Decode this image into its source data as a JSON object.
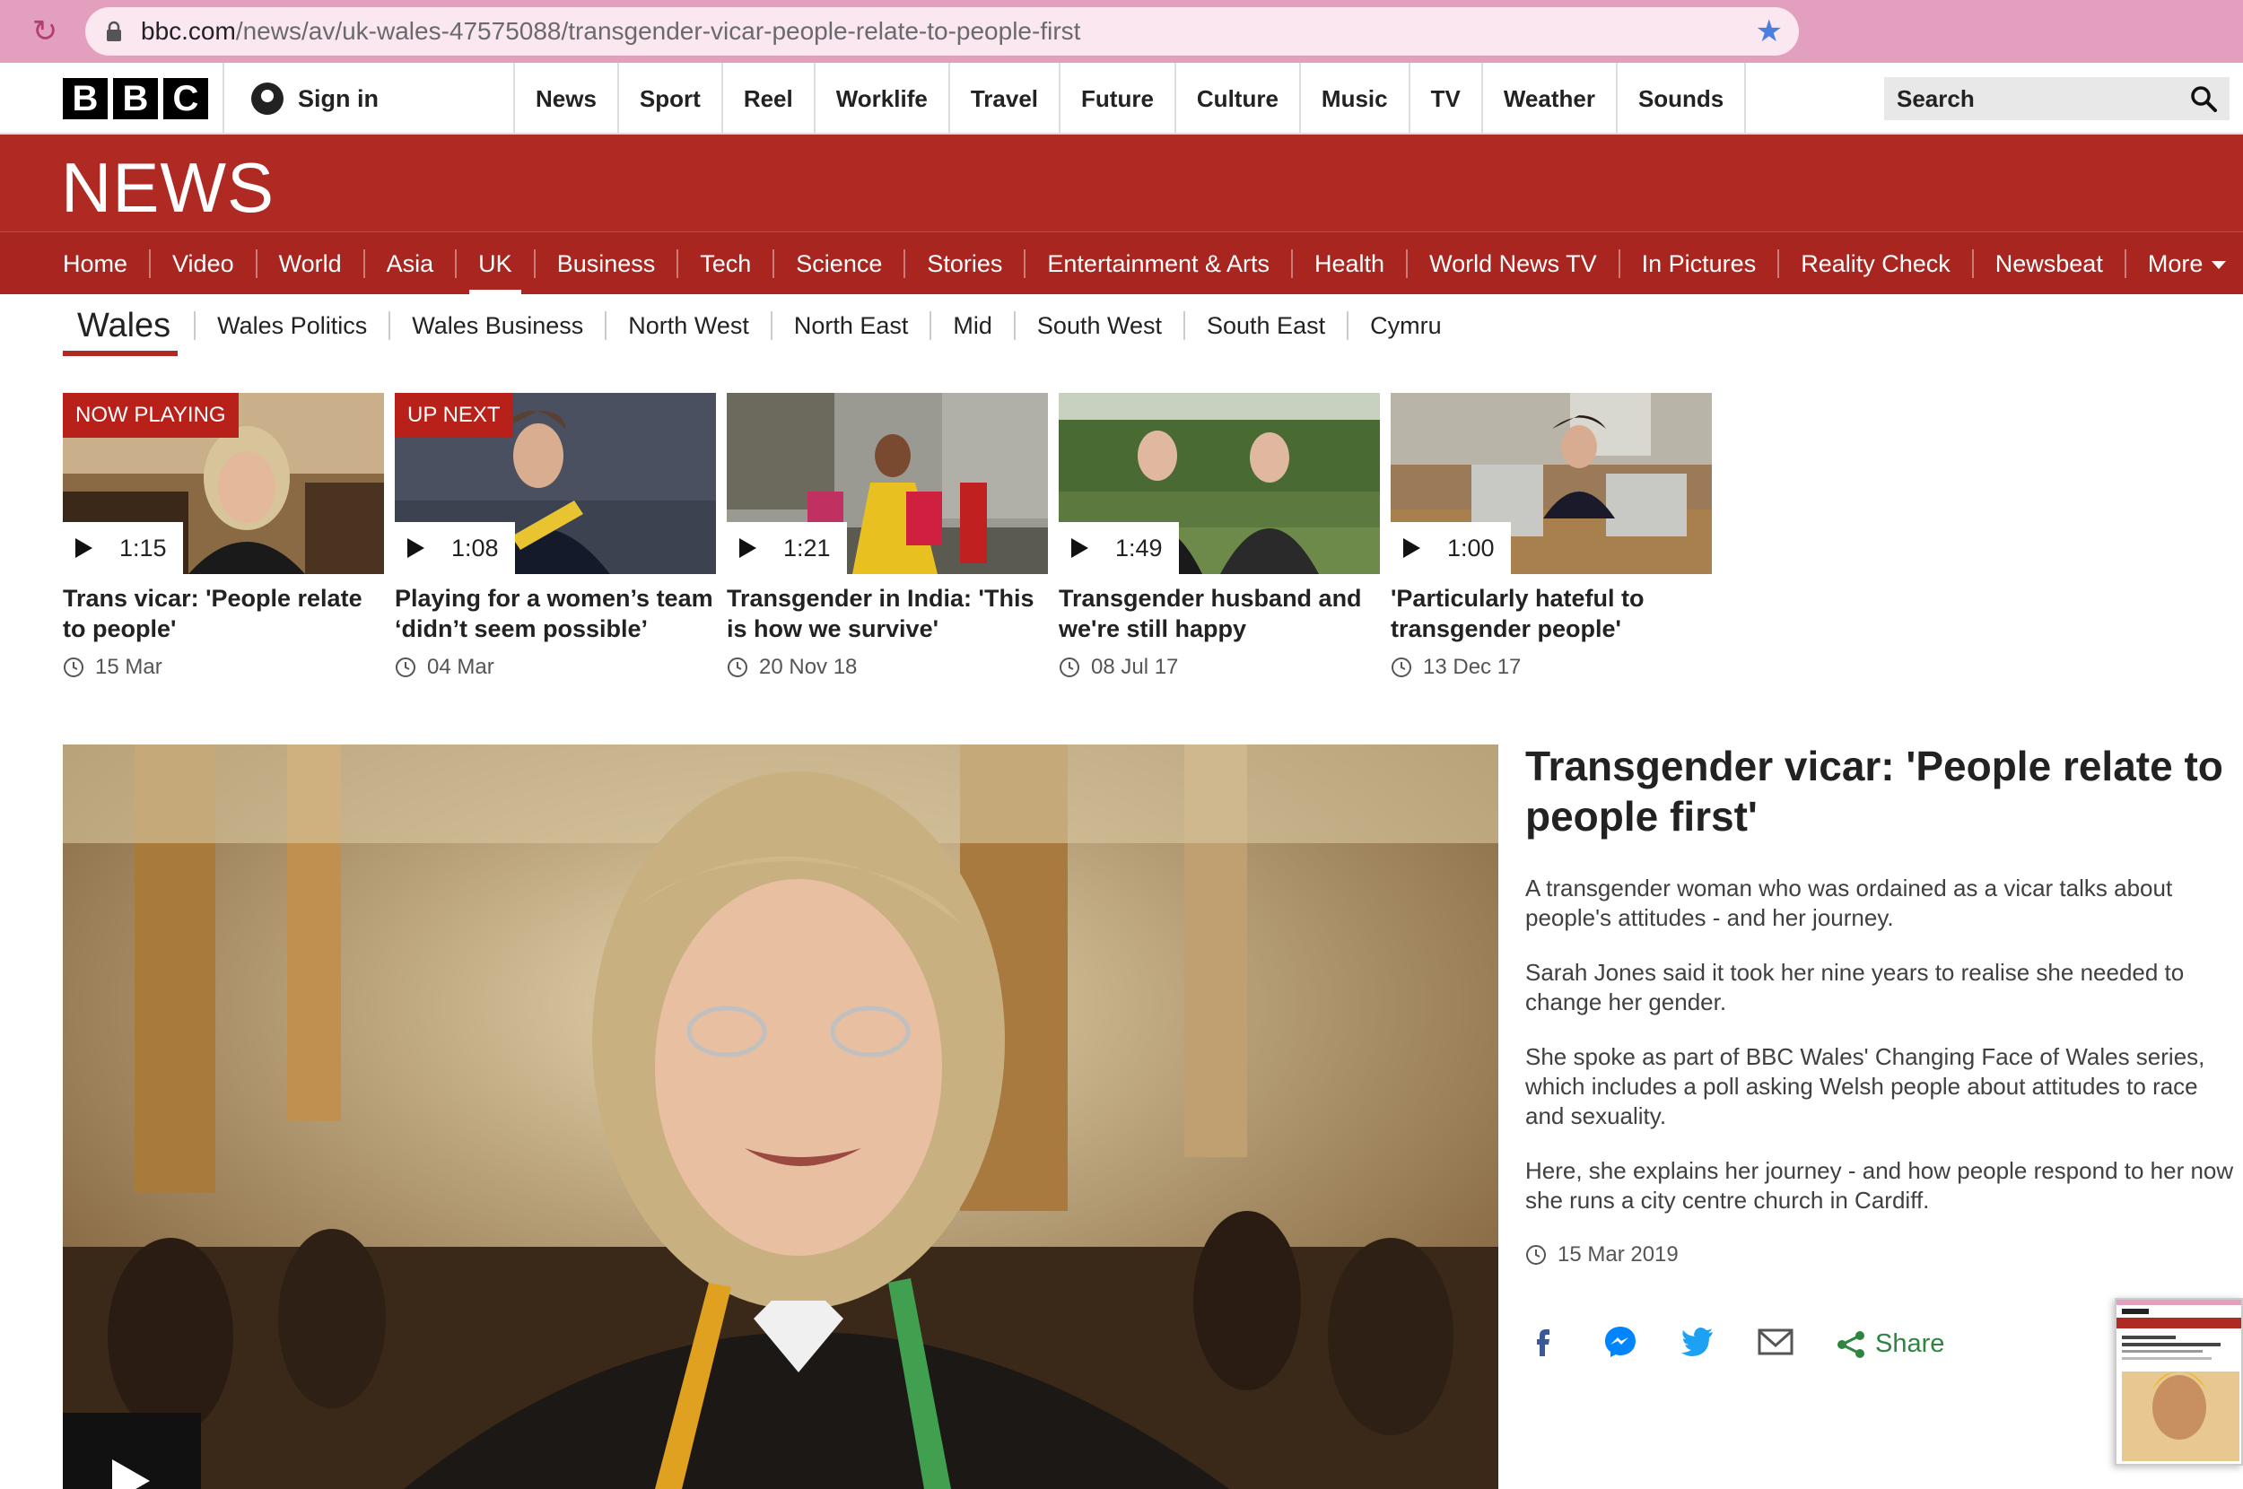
{
  "browser": {
    "url_host": "bbc.com",
    "url_path": "/news/av/uk-wales-47575088/transgender-vicar-people-relate-to-people-first"
  },
  "global_nav": {
    "logo_letters": [
      "B",
      "B",
      "C"
    ],
    "sign_in": "Sign in",
    "links": [
      "News",
      "Sport",
      "Reel",
      "Worklife",
      "Travel",
      "Future",
      "Culture",
      "Music",
      "TV",
      "Weather",
      "Sounds"
    ],
    "search_label": "Search"
  },
  "banner": {
    "title": "NEWS"
  },
  "section_nav": {
    "items": [
      "Home",
      "Video",
      "World",
      "Asia",
      "UK",
      "Business",
      "Tech",
      "Science",
      "Stories",
      "Entertainment & Arts",
      "Health",
      "World News TV",
      "In Pictures",
      "Reality Check",
      "Newsbeat",
      "More"
    ],
    "active": "UK"
  },
  "sub_nav": {
    "home": "Wales",
    "items": [
      "Wales Politics",
      "Wales Business",
      "North West",
      "North East",
      "Mid",
      "South West",
      "South East",
      "Cymru"
    ]
  },
  "carousel": [
    {
      "badge": "NOW PLAYING",
      "duration": "1:15",
      "title": "Trans vicar: 'People relate to people'",
      "date": "15 Mar"
    },
    {
      "badge": "UP NEXT",
      "duration": "1:08",
      "title": "Playing for a women’s team ‘didn’t seem possible’",
      "date": "04 Mar"
    },
    {
      "badge": "",
      "duration": "1:21",
      "title": "Transgender in India: 'This is how we survive'",
      "date": "20 Nov 18"
    },
    {
      "badge": "",
      "duration": "1:49",
      "title": "Transgender husband and we're still happy",
      "date": "08 Jul 17"
    },
    {
      "badge": "",
      "duration": "1:00",
      "title": "'Particularly hateful to transgender people'",
      "date": "13 Dec 17"
    }
  ],
  "article": {
    "headline": "Transgender vicar: 'People relate to people first'",
    "paragraphs": [
      "A transgender woman who was ordained as a vicar talks about people's attitudes - and her journey.",
      "Sarah Jones said it took her nine years to realise she needed to change her gender.",
      "She spoke as part of BBC Wales' Changing Face of Wales series, which includes a poll asking Welsh people about attitudes to race and sexuality.",
      "Here, she explains her journey - and how people respond to her now she runs a city centre church in Cardiff."
    ],
    "date": "15 Mar 2019",
    "share_label": "Share"
  },
  "colors": {
    "bbc_red": "#b02a24",
    "badge_red": "#b8211a",
    "share_green": "#2e8540",
    "facebook": "#3b5998",
    "twitter": "#1da1f2",
    "messenger": "#0084ff"
  }
}
